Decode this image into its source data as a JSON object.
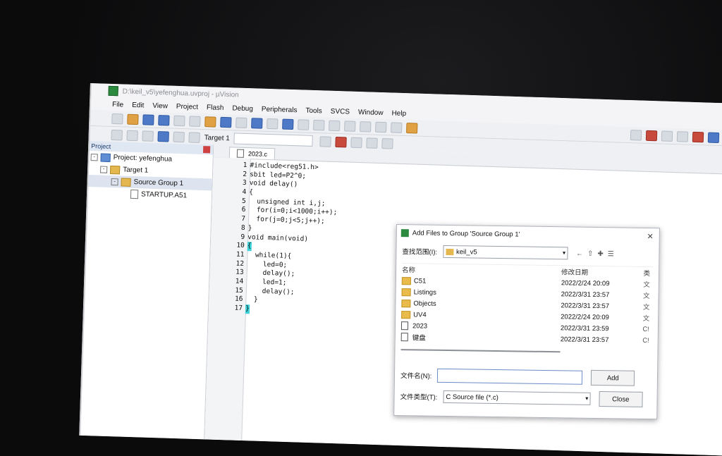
{
  "window": {
    "title": "D:\\keil_v5\\yefenghua.uvproj - µVision"
  },
  "menu": [
    "File",
    "Edit",
    "View",
    "Project",
    "Flash",
    "Debug",
    "Peripherals",
    "Tools",
    "SVCS",
    "Window",
    "Help"
  ],
  "toolbar": {
    "target": "Target 1"
  },
  "project": {
    "header": "Project",
    "root": "Project: yefenghua",
    "target": "Target 1",
    "group": "Source Group 1",
    "file": "STARTUP.A51"
  },
  "editor": {
    "tab": "2023.c",
    "lines": [
      {
        "n": "1",
        "t": "#include<reg51.h>"
      },
      {
        "n": "2",
        "t": "sbit led=P2^0;"
      },
      {
        "n": "3",
        "t": "void delay()"
      },
      {
        "n": "4",
        "t": "{"
      },
      {
        "n": "5",
        "t": "  unsigned int i,j;"
      },
      {
        "n": "6",
        "t": "  for(i=0;i<1000;i++);"
      },
      {
        "n": "7",
        "t": "  for(j=0;j<5;j++);"
      },
      {
        "n": "8",
        "t": "}"
      },
      {
        "n": "9",
        "t": "void main(void)"
      },
      {
        "n": "10",
        "t": "{"
      },
      {
        "n": "11",
        "t": "  while(1){"
      },
      {
        "n": "12",
        "t": "    led=0;"
      },
      {
        "n": "13",
        "t": "    delay();"
      },
      {
        "n": "14",
        "t": "    led=1;"
      },
      {
        "n": "15",
        "t": "    delay();"
      },
      {
        "n": "16",
        "t": "  }"
      },
      {
        "n": "17",
        "t": "}"
      }
    ]
  },
  "dialog": {
    "title": "Add Files to Group 'Source Group 1'",
    "look_in_label": "查找范围(I):",
    "look_in_value": "keil_v5",
    "col_name": "名称",
    "col_date": "修改日期",
    "col_type": "类",
    "files": [
      {
        "name": "C51",
        "date": "2022/2/24 20:09",
        "type": "文",
        "kind": "folder"
      },
      {
        "name": "Listings",
        "date": "2022/3/31 23:57",
        "type": "文",
        "kind": "folder"
      },
      {
        "name": "Objects",
        "date": "2022/3/31 23:57",
        "type": "文",
        "kind": "folder"
      },
      {
        "name": "UV4",
        "date": "2022/2/24 20:09",
        "type": "文",
        "kind": "folder"
      },
      {
        "name": "2023",
        "date": "2022/3/31 23:59",
        "type": "C!",
        "kind": "file"
      },
      {
        "name": "键盘",
        "date": "2022/3/31 23:57",
        "type": "C!",
        "kind": "file"
      }
    ],
    "filename_label": "文件名(N):",
    "filename_value": "",
    "filetype_label": "文件类型(T):",
    "filetype_value": "C Source file (*.c)",
    "add_label": "Add",
    "close_label": "Close"
  }
}
